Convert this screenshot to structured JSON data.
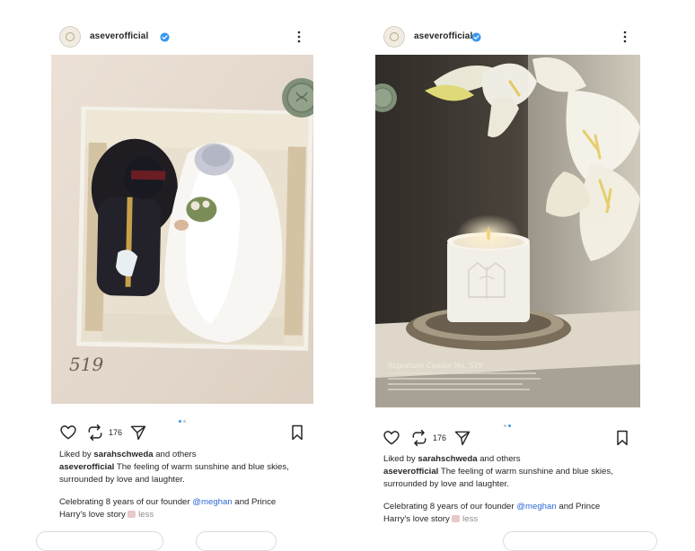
{
  "posts": [
    {
      "username": "aseverofficial",
      "image_signature": "519",
      "repost_count": "176",
      "liked_prefix": "Liked by ",
      "liked_user": "sarahschweda",
      "liked_suffix": " and others",
      "caption_user": "aseverofficial",
      "caption_text": " The feeling of warm sunshine and blue skies, surrounded by love and laughter.",
      "celebrating_prefix": "Celebrating 8 years of our founder ",
      "mention": "@meghan",
      "celebrating_suffix": " and Prince Harry's love story ",
      "less_label": "less",
      "carousel_active_index": 0
    },
    {
      "username": "aseverofficial",
      "overlay_title": "Signature Candle No. 519",
      "repost_count": "176",
      "liked_prefix": "Liked by ",
      "liked_user": "sarahschweda",
      "liked_suffix": " and others",
      "caption_user": "aseverofficial",
      "caption_text": " The feeling of warm sunshine and blue skies, surrounded by love and laughter.",
      "celebrating_prefix": "Celebrating 8 years of our founder ",
      "mention": "@meghan",
      "celebrating_suffix": " and Prince Harry's love story ",
      "less_label": "less",
      "carousel_active_index": 1
    }
  ],
  "icons": {
    "verified": "verified-badge-icon",
    "more": "more-options-icon",
    "like": "heart-icon",
    "repost": "repost-icon",
    "share": "send-icon",
    "save": "bookmark-icon"
  },
  "colors": {
    "verified_blue": "#3897f0",
    "mention_blue": "#2d68d8",
    "muted_text": "#8e8e8e",
    "candle_flame": "#f6d27a",
    "lily_yellow": "#e8d06a"
  }
}
